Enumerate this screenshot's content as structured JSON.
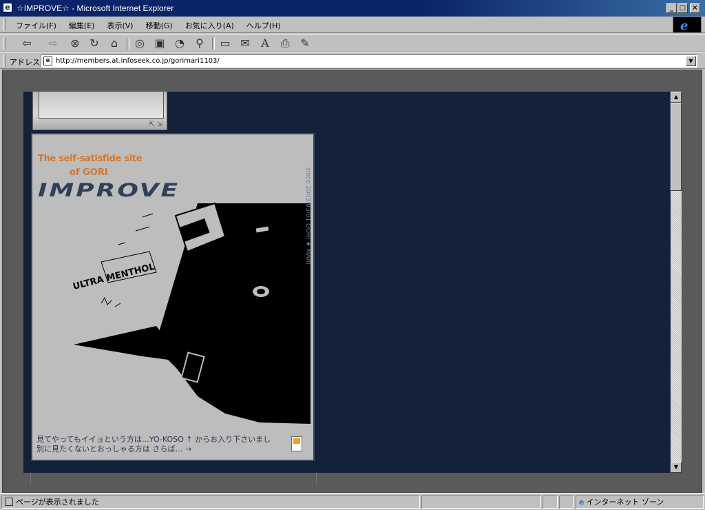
{
  "window": {
    "title": "☆IMPROVE☆ - Microsoft Internet Explorer",
    "app_icon": "ie-page-icon",
    "controls": {
      "minimize": "_",
      "maximize": "□",
      "close": "×"
    }
  },
  "menubar": {
    "items": [
      "ファイル(F)",
      "編集(E)",
      "表示(V)",
      "移動(G)",
      "お気に入り(A)",
      "ヘルプ(H)"
    ]
  },
  "toolbar": {
    "buttons": [
      "back",
      "forward",
      "stop",
      "refresh",
      "home",
      "search",
      "favorites",
      "history",
      "channels",
      "fullscreen",
      "mail",
      "fonts",
      "print",
      "edit"
    ],
    "glyphs": {
      "back": "⇦",
      "forward": "⇨",
      "stop": "⊗",
      "refresh": "↻",
      "home": "⌂",
      "search": "◎",
      "favorites": "▣",
      "history": "◔",
      "channels": "⚲",
      "fullscreen": "▭",
      "mail": "✉",
      "fonts": "A",
      "print": "⎙",
      "edit": "✎"
    }
  },
  "addressbar": {
    "label": "アドレス",
    "url": "http://members.at.infoseek.co.jp/gorimari1103/"
  },
  "page": {
    "tagline_1": "The self-satisfide site",
    "tagline_2": "of GORI",
    "logo": "IMPROVE",
    "image_text": "ULTRA MENTHOL",
    "vertical_text": "since 2003/03/01 GORI ★ MARI",
    "message_1": "見てやってもイイョという方は…YO-KOSO ↑ からお入り下さいまし",
    "message_2": "別に見たくないとおっしゃる方は さらば… →",
    "colors": {
      "background": "#13213a",
      "card": "#bdbdbd",
      "accent": "#d4762f",
      "logo": "#2f4158"
    }
  },
  "statusbar": {
    "text": "ページが表示されました",
    "zone": "インターネット ゾーン"
  }
}
